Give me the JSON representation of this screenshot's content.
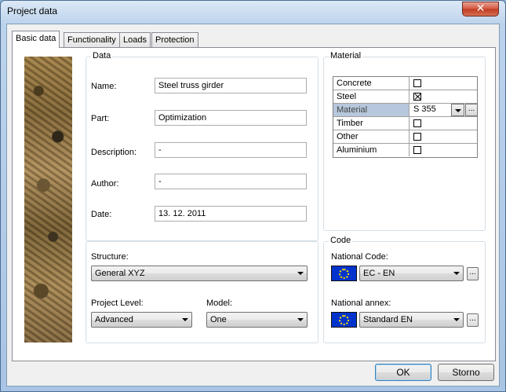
{
  "window": {
    "title": "Project data",
    "close_glyph": "✕"
  },
  "tabs": [
    {
      "label": "Basic data",
      "active": true
    },
    {
      "label": "Functionality",
      "active": false
    },
    {
      "label": "Loads",
      "active": false
    },
    {
      "label": "Protection",
      "active": false
    }
  ],
  "data_group": {
    "label": "Data",
    "name_label": "Name:",
    "name_value": "Steel truss girder",
    "part_label": "Part:",
    "part_value": "Optimization",
    "description_label": "Description:",
    "description_value": "-",
    "author_label": "Author:",
    "author_value": "-",
    "date_label": "Date:",
    "date_value": "13. 12. 2011"
  },
  "structure_group": {
    "structure_label": "Structure:",
    "structure_value": "General XYZ",
    "project_level_label": "Project Level:",
    "project_level_value": "Advanced",
    "model_label": "Model:",
    "model_value": "One"
  },
  "material_group": {
    "label": "Material",
    "rows": [
      {
        "name": "Concrete",
        "checked": false
      },
      {
        "name": "Steel",
        "checked": true
      },
      {
        "name": "Material",
        "value": "S 355",
        "dots": "..."
      },
      {
        "name": "Timber",
        "checked": false
      },
      {
        "name": "Other",
        "checked": false
      },
      {
        "name": "Aluminium",
        "checked": false
      }
    ]
  },
  "code_group": {
    "label": "Code",
    "national_code_label": "National Code:",
    "national_code_value": "EC - EN",
    "national_annex_label": "National annex:",
    "national_annex_value": "Standard EN",
    "dots": "..."
  },
  "buttons": {
    "ok": "OK",
    "cancel": "Storno"
  },
  "colors": {
    "eu_flag_blue": "#0033cc",
    "eu_flag_stars": "#ffdd00",
    "selected_row": "#b7c7dc"
  }
}
